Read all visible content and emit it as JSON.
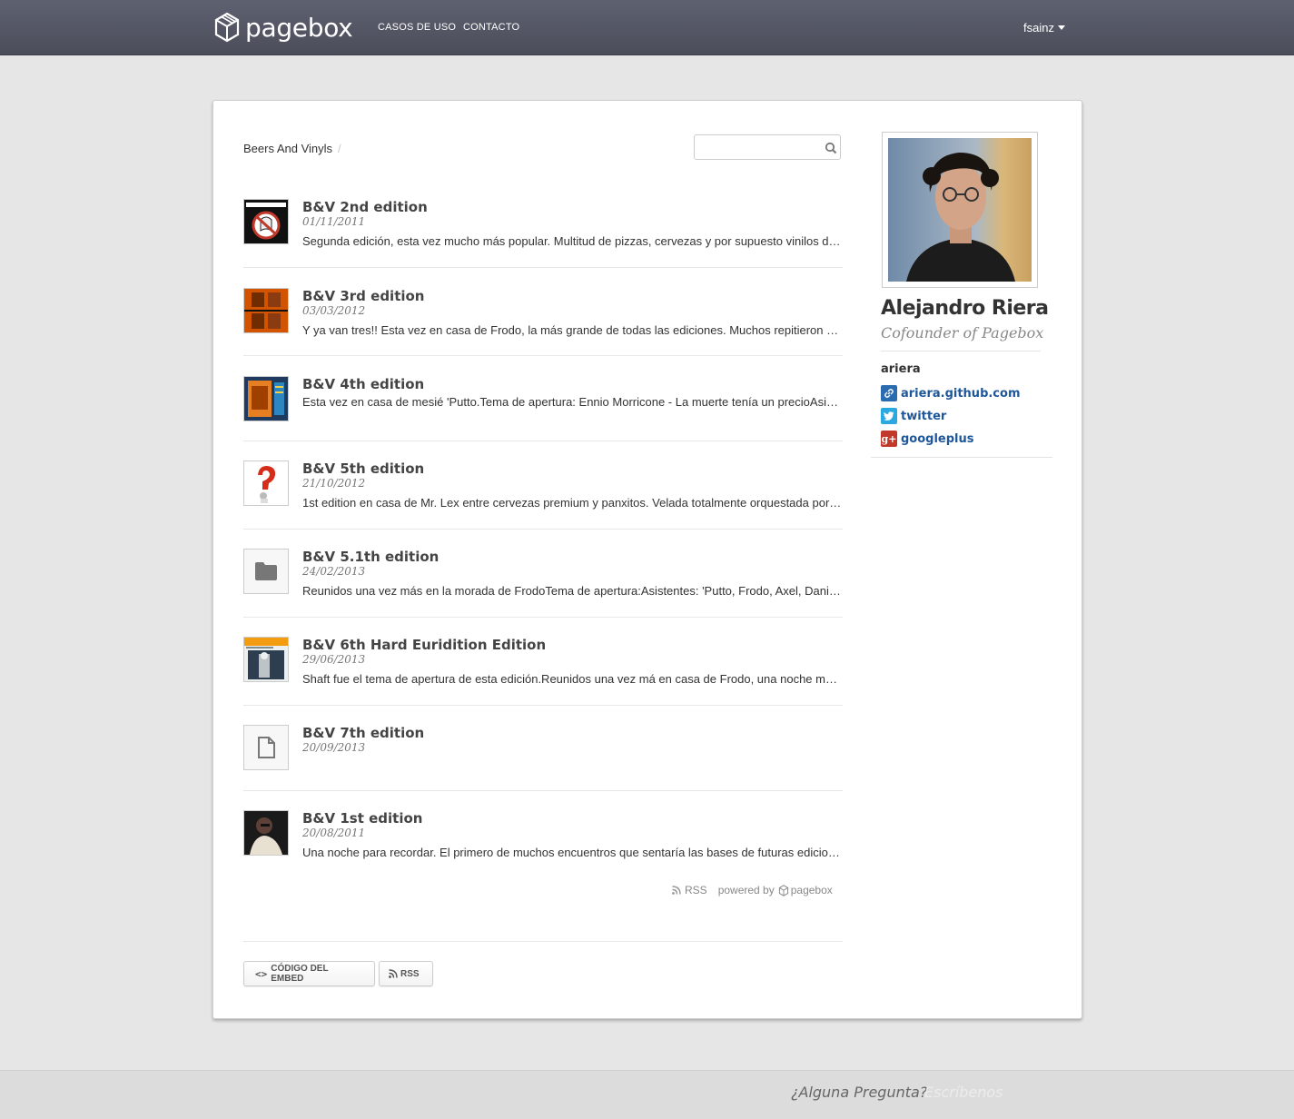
{
  "nav": {
    "brand": "pagebox",
    "links": [
      "CASOS DE USO",
      "CONTACTO"
    ],
    "user": "fsainz"
  },
  "breadcrumb": {
    "current": "Beers And Vinyls",
    "separator": "/"
  },
  "search": {
    "placeholder": "",
    "value": ""
  },
  "items": [
    {
      "title": "B&V 2nd edition",
      "date": "01/11/2011",
      "description": "Segunda edición, esta vez mucho más popular. Multitud de pizzas, cervezas y por supuesto vinilos de todo tipo",
      "thumb": "ghostbusters"
    },
    {
      "title": "B&V 3rd edition",
      "date": "03/03/2012",
      "description": "Y ya van tres!! Esta vez en casa de Frodo, la más grande de todas las ediciones. Muchos repitieron y otros nuevos",
      "thumb": "western"
    },
    {
      "title": "B&V 4th edition",
      "date": "",
      "description": "Esta vez en casa de mesié 'Putto.Tema de apertura: Ennio Morricone - La muerte tenía un precioAsistentes",
      "thumb": "poster"
    },
    {
      "title": "B&V 5th edition",
      "date": "21/10/2012",
      "description": "1st edition en casa de Mr. Lex entre cervezas premium y panxitos. Velada totalmente orquestada por el anfitrión",
      "thumb": "question"
    },
    {
      "title": "B&V 5.1th edition",
      "date": "24/02/2013",
      "description": "Reunidos una vez más en la morada de FrodoTema de apertura:Asistentes: 'Putto, Frodo, Axel, Dani y más",
      "thumb": "folder-icon"
    },
    {
      "title": "B&V 6th Hard Euridition Edition",
      "date": "29/06/2013",
      "description": "Shaft fue el tema de apertura de esta edición.Reunidos una vez má en casa de Frodo, una noche memorable",
      "thumb": "jazz"
    },
    {
      "title": "B&V 7th edition",
      "date": "20/09/2013",
      "description": "",
      "thumb": "file-icon"
    },
    {
      "title": "B&V 1st edition",
      "date": "20/08/2011",
      "description": "Una noche para recordar. El primero de muchos encuentros que sentaría las bases de futuras ediciones",
      "thumb": "shaft"
    }
  ],
  "powered": {
    "rss": "RSS",
    "powered_by": "powered by",
    "brand": "pagebox"
  },
  "buttons": {
    "embed": "CÓDIGO DEL EMBED",
    "rss": "RSS"
  },
  "profile": {
    "name": "Alejandro Riera",
    "role": "Cofounder of Pagebox",
    "username": "ariera",
    "links": [
      {
        "label": "ariera.github.com",
        "icon": "link-icon",
        "color": "#2b6cb0"
      },
      {
        "label": "twitter",
        "icon": "twitter-icon",
        "color": "#2aa9e0"
      },
      {
        "label": "googleplus",
        "icon": "googleplus-icon",
        "color": "#c0392b"
      }
    ]
  },
  "footer": {
    "question": "¿Alguna Pregunta?",
    "link": "Escríbenos"
  },
  "colors": {
    "navbar": "#525461",
    "link": "#1e5799",
    "background": "#e6e6e6"
  }
}
